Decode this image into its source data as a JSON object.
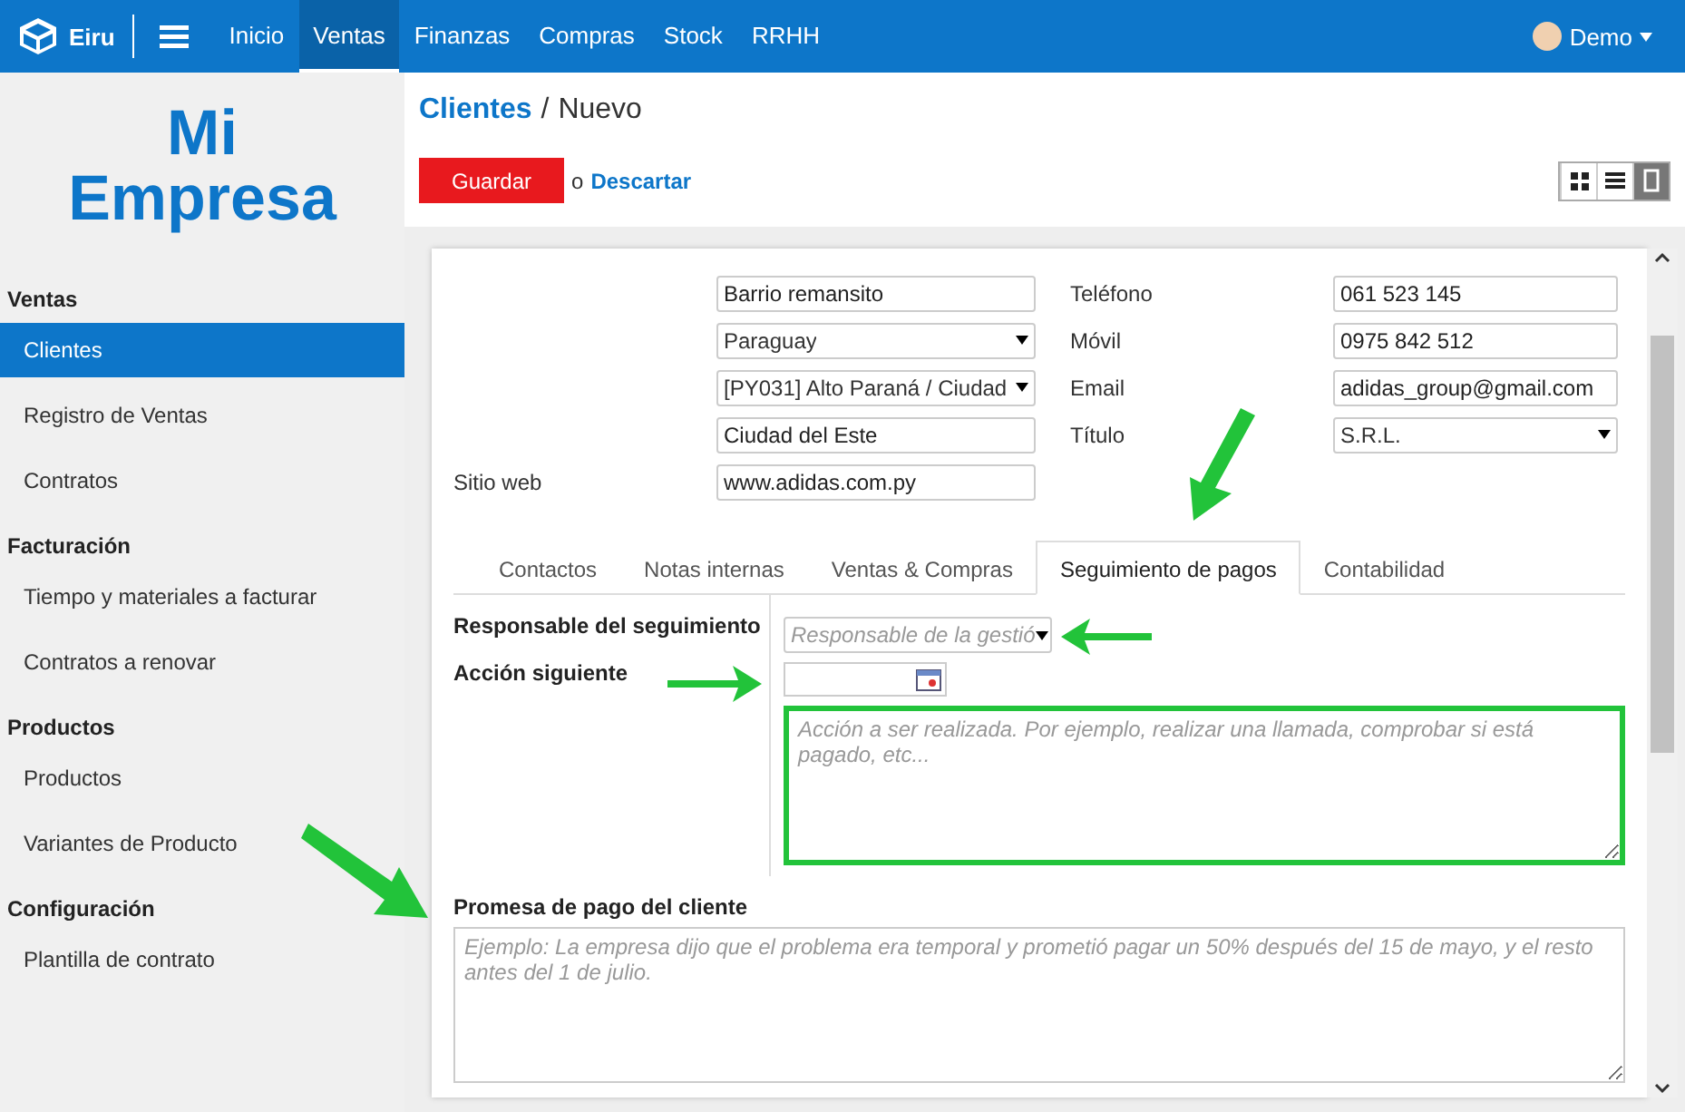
{
  "topbar": {
    "brand": "Eiru",
    "menu": [
      {
        "label": "Inicio",
        "selected": false
      },
      {
        "label": "Ventas",
        "selected": true
      },
      {
        "label": "Finanzas",
        "selected": false
      },
      {
        "label": "Compras",
        "selected": false
      },
      {
        "label": "Stock",
        "selected": false
      },
      {
        "label": "RRHH",
        "selected": false
      }
    ],
    "user": "Demo"
  },
  "sidebar": {
    "company": "Mi Empresa",
    "sections": [
      {
        "title": "Ventas",
        "items": [
          {
            "label": "Clientes",
            "selected": true
          },
          {
            "label": "Registro de Ventas",
            "selected": false
          },
          {
            "label": "Contratos",
            "selected": false
          }
        ]
      },
      {
        "title": "Facturación",
        "items": [
          {
            "label": "Tiempo y materiales a facturar",
            "selected": false
          },
          {
            "label": "Contratos a renovar",
            "selected": false
          }
        ]
      },
      {
        "title": "Productos",
        "items": [
          {
            "label": "Productos",
            "selected": false
          },
          {
            "label": "Variantes de Producto",
            "selected": false
          }
        ]
      },
      {
        "title": "Configuración",
        "items": [
          {
            "label": "Plantilla de contrato",
            "selected": false
          }
        ]
      }
    ]
  },
  "breadcrumb": {
    "parent": "Clientes",
    "separator": "/",
    "current": "Nuevo"
  },
  "actions": {
    "save": "Guardar",
    "or": "o",
    "discard": "Descartar"
  },
  "views": [
    {
      "kind": "kanban",
      "selected": false
    },
    {
      "kind": "list",
      "selected": false
    },
    {
      "kind": "form",
      "selected": true
    }
  ],
  "form": {
    "left": [
      {
        "value": "Barrio remansito",
        "kind": "text"
      },
      {
        "value": "Paraguay",
        "kind": "select"
      },
      {
        "value": "[PY031] Alto Paraná / Ciudad",
        "kind": "select"
      },
      {
        "value": "Ciudad del Este",
        "kind": "text"
      },
      {
        "label": "Sitio web",
        "value": "www.adidas.com.py",
        "kind": "text"
      }
    ],
    "right": [
      {
        "label": "Teléfono",
        "value": "061 523 145",
        "kind": "text"
      },
      {
        "label": "Móvil",
        "value": "0975 842 512",
        "kind": "text"
      },
      {
        "label": "Email",
        "value": "adidas_group@gmail.com",
        "kind": "text"
      },
      {
        "label": "Título",
        "value": "S.R.L.",
        "kind": "select"
      }
    ],
    "tabs": [
      {
        "label": "Contactos",
        "selected": false
      },
      {
        "label": "Notas internas",
        "selected": false
      },
      {
        "label": "Ventas & Compras",
        "selected": false
      },
      {
        "label": "Seguimiento de pagos",
        "selected": true
      },
      {
        "label": "Contabilidad",
        "selected": false
      }
    ],
    "followup": {
      "responsible_label": "Responsable del seguimiento",
      "responsible_placeholder": "Responsable de la gestió",
      "next_action_label": "Acción siguiente",
      "next_action_placeholder": "Acción a ser realizada. Por ejemplo, realizar una llamada, comprobar si está pagado, etc...",
      "promise_label": "Promesa de pago del cliente",
      "promise_placeholder": "Ejemplo: La empresa dijo que el problema era temporal y prometió pagar un 50% después del 15 de mayo, y el resto antes del 1 de julio."
    }
  }
}
